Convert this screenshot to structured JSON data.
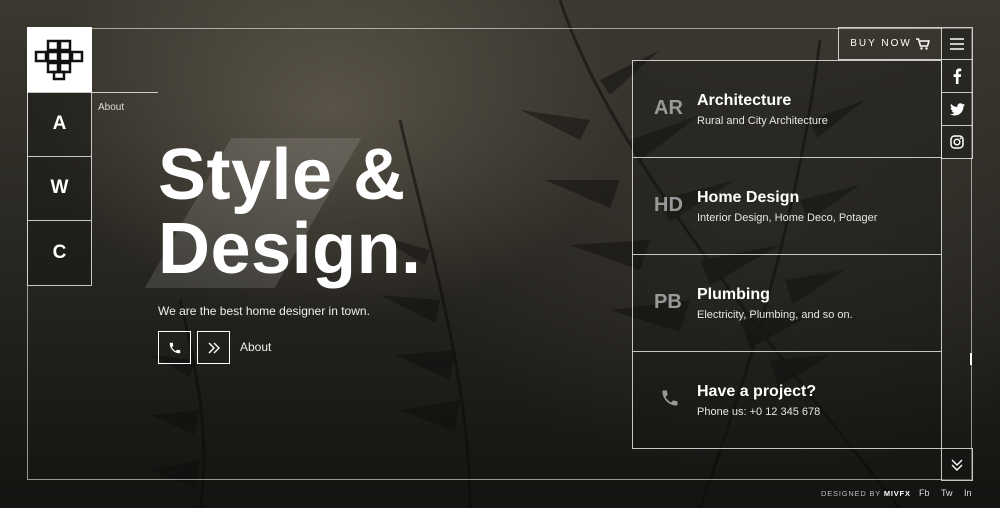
{
  "brand": {
    "logo_icon": "cross-pattern-logo-icon"
  },
  "left_nav": {
    "items": [
      {
        "label": "A"
      },
      {
        "label": "W"
      },
      {
        "label": "C"
      }
    ],
    "about_label": "About"
  },
  "hero": {
    "title_line1": "Style &",
    "title_line2": "Design.",
    "tagline": "We are the best home designer in town.",
    "call_icon": "phone-icon",
    "next_icon": "double-chevron-right-icon",
    "about_link": "About"
  },
  "services": [
    {
      "abbr": "AR",
      "title": "Architecture",
      "subtitle": "Rural and City Architecture"
    },
    {
      "abbr": "HD",
      "title": "Home Design",
      "subtitle": "Interior Design, Home Deco, Potager"
    },
    {
      "abbr": "PB",
      "title": "Plumbing",
      "subtitle": "Electricity, Plumbing, and so on."
    }
  ],
  "project": {
    "title": "Have a project?",
    "phone": "Phone us: +0 12 345 678",
    "icon": "phone-icon"
  },
  "header": {
    "buy_label": "BUY NOW",
    "cart_icon": "cart-icon",
    "menu_icon": "hamburger-menu-icon"
  },
  "social": {
    "icons": [
      "facebook-icon",
      "twitter-icon",
      "instagram-icon"
    ]
  },
  "footer": {
    "designed_by": "DESIGNED BY",
    "designer": "MIVFX",
    "links": [
      "Fb",
      "Tw",
      "In"
    ]
  },
  "colors": {
    "background": "#1b1a17",
    "line": "#ffffff",
    "abbr": "#999999"
  }
}
